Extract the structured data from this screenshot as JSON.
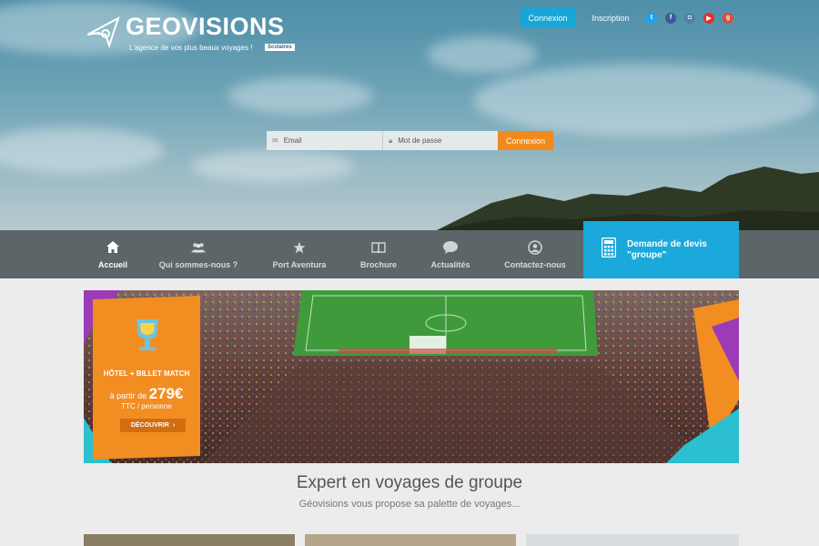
{
  "brand": {
    "name": "GEOVISIONS",
    "tagline": "L'agence de vos plus beaux voyages !",
    "badge": "Scolaires"
  },
  "header": {
    "login_button": "Connexion",
    "signup_button": "Inscription",
    "social": [
      {
        "name": "twitter-icon",
        "glyph": "t",
        "color": "#1da1f2"
      },
      {
        "name": "facebook-icon",
        "glyph": "f",
        "color": "#3b5998"
      },
      {
        "name": "instagram-icon",
        "glyph": "◘",
        "color": "#517fa4"
      },
      {
        "name": "youtube-icon",
        "glyph": "▶",
        "color": "#e52d27"
      },
      {
        "name": "google-plus-icon",
        "glyph": "g",
        "color": "#dd4b39"
      }
    ]
  },
  "login_form": {
    "email_placeholder": "Email",
    "password_placeholder": "Mot de passe",
    "submit_label": "Connexion"
  },
  "nav": {
    "items": [
      {
        "label": "Accueil",
        "icon": "home-icon",
        "active": true
      },
      {
        "label": "Qui sommes-nous ?",
        "icon": "team-icon",
        "active": false
      },
      {
        "label": "Port Aventura",
        "icon": "star-icon",
        "active": false
      },
      {
        "label": "Brochure",
        "icon": "book-icon",
        "active": false
      },
      {
        "label": "Actualités",
        "icon": "speech-bubble-icon",
        "active": false
      },
      {
        "label": "Contactez-nous",
        "icon": "contact-icon",
        "active": false
      }
    ],
    "quote_cta": {
      "line1": "Demande de devis",
      "line2": "\"groupe\"",
      "icon": "calculator-icon"
    }
  },
  "promo": {
    "title": "HÔTEL + BILLET MATCH",
    "from_label": "à partir de",
    "price": "279€",
    "price_note": "TTC / personne",
    "button_label": "DÉCOUVRIR",
    "button_icon": "chevron-right-icon"
  },
  "section": {
    "title": "Expert en voyages de groupe",
    "subtitle": "Géovisions vous propose sa palette de voyages..."
  },
  "colors": {
    "accent_blue": "#1aa9da",
    "accent_orange": "#f08a1c",
    "nav_bg": "#5c6568"
  }
}
